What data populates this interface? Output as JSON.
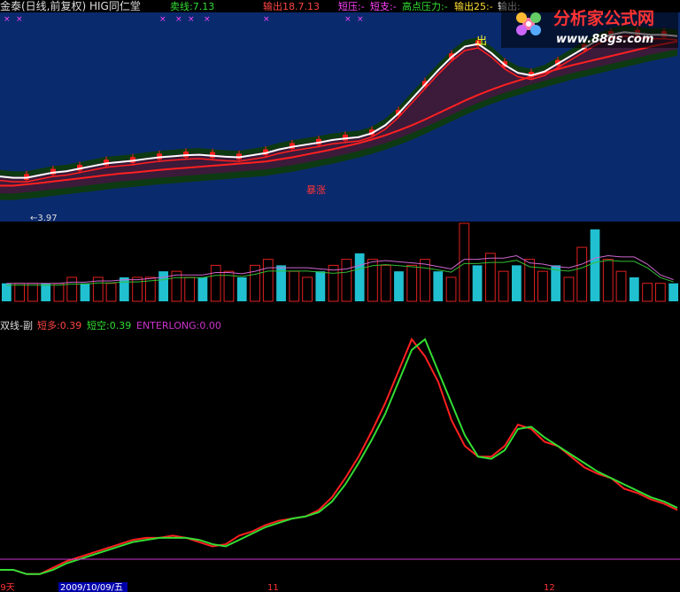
{
  "main_header": {
    "title": "金泰(日线,前复权) HIG同仁堂",
    "sell_line": "卖线:7.13",
    "output1": "输出18.7.13",
    "short_press": "短压:-",
    "short_support": "短支:-",
    "high_press": "高点压力:-",
    "output25": "输出25:-",
    "output_more": "输出:"
  },
  "watermark": {
    "name": "分析家公式网",
    "url": "www.88gs.com"
  },
  "main_annotations": {
    "exit_marker": "出",
    "surge_marker": "暴涨",
    "low_price": "←3.97"
  },
  "sub_header": {
    "title": "双线-副",
    "short_long": "短多:0.39",
    "short_short": "短空:0.39",
    "enterlong": "ENTERLONG:0.00"
  },
  "date_axis": {
    "left_partial": "09天",
    "selected_date": "2009/10/09/五",
    "mark_11": "11",
    "mark_12": "12"
  },
  "colors": {
    "background": "#000000",
    "main_panel_bg": "#0a2a6e",
    "up_candle": "#ff2020",
    "volume_up": "#e02020",
    "volume_down": "#20c0d0",
    "short_long_line": "#ff2020",
    "short_short_line": "#33dd33",
    "enterlong_line": "#cc33cc",
    "axis_text": "#ff3333",
    "date_highlight": "#0000aa"
  },
  "chart_data": [
    {
      "type": "line",
      "name": "price-panel",
      "x": [
        0,
        15,
        30,
        45,
        60,
        75,
        90,
        105,
        120,
        135,
        150,
        165,
        180,
        195,
        210,
        225,
        240,
        255,
        270,
        285,
        300,
        315,
        330,
        345,
        360,
        375,
        390,
        405,
        420,
        435,
        450,
        465,
        480,
        495,
        510,
        525,
        540,
        555,
        570,
        585,
        600,
        615,
        630,
        645,
        660,
        675,
        690,
        705,
        720,
        735,
        750,
        765
      ],
      "series": [
        {
          "name": "white",
          "values": [
            5.55,
            5.5,
            5.5,
            5.6,
            5.7,
            5.75,
            5.85,
            5.95,
            6.05,
            6.1,
            6.15,
            6.22,
            6.28,
            6.32,
            6.36,
            6.38,
            6.34,
            6.3,
            6.28,
            6.36,
            6.44,
            6.58,
            6.68,
            6.76,
            6.84,
            6.94,
            7.0,
            7.05,
            7.2,
            7.5,
            7.95,
            8.5,
            9.05,
            9.6,
            10.1,
            10.5,
            10.6,
            10.25,
            9.8,
            9.5,
            9.4,
            9.55,
            9.85,
            10.15,
            10.45,
            10.75,
            10.95,
            11.05,
            11.0,
            10.95,
            10.95,
            10.9
          ]
        },
        {
          "name": "red",
          "values": [
            5.2,
            5.2,
            5.25,
            5.3,
            5.36,
            5.42,
            5.48,
            5.54,
            5.6,
            5.66,
            5.7,
            5.75,
            5.8,
            5.84,
            5.88,
            5.92,
            5.96,
            6.0,
            6.04,
            6.08,
            6.12,
            6.2,
            6.28,
            6.38,
            6.48,
            6.58,
            6.7,
            6.82,
            6.96,
            7.12,
            7.3,
            7.5,
            7.72,
            7.96,
            8.2,
            8.44,
            8.66,
            8.86,
            9.04,
            9.2,
            9.36,
            9.5,
            9.64,
            9.78,
            9.9,
            10.02,
            10.14,
            10.26,
            10.38,
            10.5,
            10.6,
            10.7
          ]
        }
      ]
    },
    {
      "type": "bar",
      "name": "volume-panel",
      "values": [
        3,
        3,
        3,
        3,
        3,
        4,
        3,
        4,
        3,
        4,
        4,
        4,
        5,
        5,
        4,
        4,
        6,
        5,
        4,
        6,
        7,
        6,
        5,
        4,
        5,
        6,
        7,
        8,
        7,
        6,
        5,
        6,
        7,
        5,
        4,
        13,
        6,
        8,
        5,
        6,
        7,
        5,
        6,
        4,
        9,
        12,
        7,
        5,
        4,
        3,
        3,
        3
      ]
    },
    {
      "type": "line",
      "name": "sub-panel",
      "x": [
        0,
        15,
        30,
        45,
        60,
        75,
        90,
        105,
        120,
        135,
        150,
        165,
        180,
        195,
        210,
        225,
        240,
        255,
        270,
        285,
        300,
        315,
        330,
        345,
        360,
        375,
        390,
        405,
        420,
        435,
        450,
        465,
        480,
        495,
        510,
        525,
        540,
        555,
        570,
        585,
        600,
        615,
        630,
        645,
        660,
        675,
        690,
        705,
        720,
        735,
        750,
        765
      ],
      "series": [
        {
          "name": "短多",
          "values": [
            0.02,
            0.02,
            0.0,
            0.0,
            0.03,
            0.06,
            0.08,
            0.1,
            0.12,
            0.14,
            0.16,
            0.17,
            0.17,
            0.18,
            0.17,
            0.15,
            0.13,
            0.14,
            0.18,
            0.2,
            0.23,
            0.25,
            0.26,
            0.27,
            0.3,
            0.36,
            0.45,
            0.55,
            0.67,
            0.8,
            0.95,
            1.1,
            1.02,
            0.9,
            0.72,
            0.6,
            0.55,
            0.55,
            0.6,
            0.7,
            0.68,
            0.62,
            0.6,
            0.55,
            0.5,
            0.47,
            0.45,
            0.4,
            0.38,
            0.35,
            0.33,
            0.3
          ]
        },
        {
          "name": "短空",
          "values": [
            0.02,
            0.02,
            0.0,
            0.0,
            0.02,
            0.05,
            0.07,
            0.09,
            0.11,
            0.13,
            0.15,
            0.16,
            0.17,
            0.17,
            0.17,
            0.16,
            0.14,
            0.13,
            0.16,
            0.19,
            0.22,
            0.24,
            0.26,
            0.27,
            0.29,
            0.34,
            0.42,
            0.52,
            0.63,
            0.75,
            0.9,
            1.05,
            1.1,
            0.95,
            0.8,
            0.65,
            0.55,
            0.54,
            0.58,
            0.68,
            0.69,
            0.64,
            0.6,
            0.56,
            0.52,
            0.48,
            0.45,
            0.42,
            0.39,
            0.36,
            0.34,
            0.31
          ]
        }
      ]
    }
  ]
}
